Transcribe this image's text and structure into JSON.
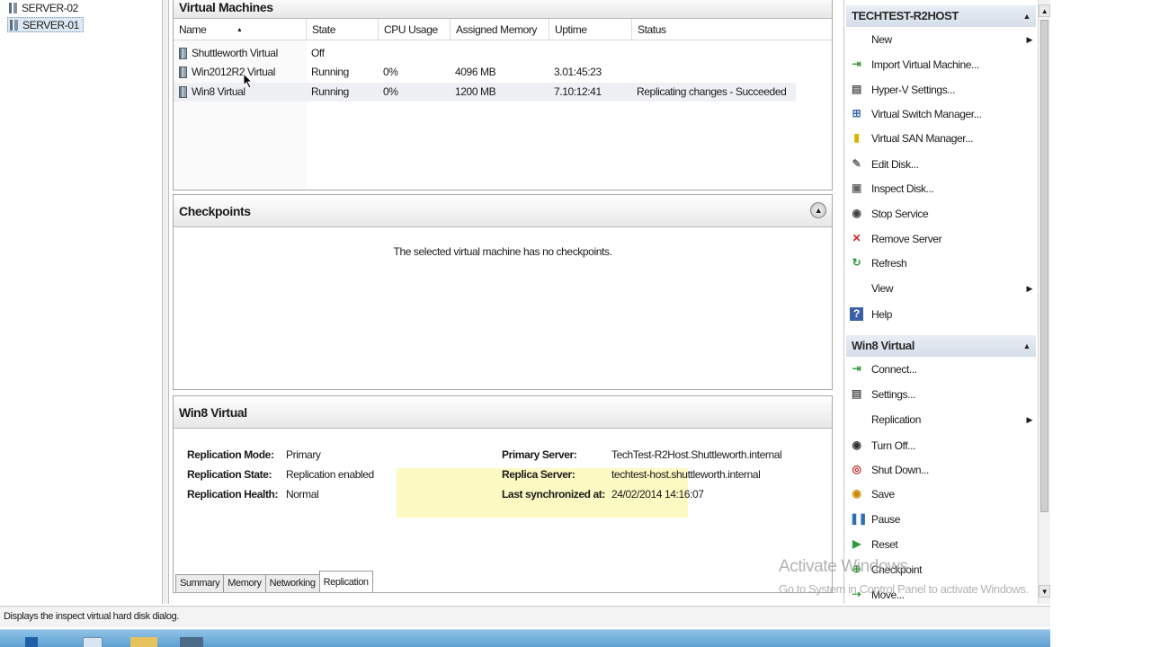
{
  "tree": {
    "items": [
      "SERVER-02",
      "SERVER-01"
    ]
  },
  "vm_panel": {
    "title": "Virtual Machines",
    "columns": [
      "Name",
      "State",
      "CPU Usage",
      "Assigned Memory",
      "Uptime",
      "Status"
    ],
    "rows": [
      {
        "name": "Shuttleworth Virtual",
        "state": "Off",
        "cpu": "",
        "memory": "",
        "uptime": "",
        "status": ""
      },
      {
        "name": "Win2012R2 Virtual",
        "state": "Running",
        "cpu": "0%",
        "memory": "4096 MB",
        "uptime": "3.01:45:23",
        "status": ""
      },
      {
        "name": "Win8 Virtual",
        "state": "Running",
        "cpu": "0%",
        "memory": "1200 MB",
        "uptime": "7.10:12:41",
        "status": "Replicating changes - Succeeded"
      }
    ]
  },
  "checkpoints": {
    "title": "Checkpoints",
    "empty_message": "The selected virtual machine has no checkpoints."
  },
  "details": {
    "title": "Win8 Virtual",
    "left": [
      {
        "label": "Replication Mode:",
        "value": "Primary"
      },
      {
        "label": "Replication State:",
        "value": "Replication enabled"
      },
      {
        "label": "Replication Health:",
        "value": "Normal"
      }
    ],
    "right": [
      {
        "label": "Primary Server:",
        "value": "TechTest-R2Host.Shuttleworth.internal"
      },
      {
        "label": "Replica Server:",
        "value": "techtest-host.shuttleworth.internal"
      },
      {
        "label": "Last synchronized at:",
        "value": "24/02/2014 14:16:07"
      }
    ],
    "tabs": [
      "Summary",
      "Memory",
      "Networking",
      "Replication"
    ]
  },
  "actions": {
    "host_title": "TECHTEST-R2HOST",
    "host_items": [
      "New",
      "Import Virtual Machine...",
      "Hyper-V Settings...",
      "Virtual Switch Manager...",
      "Virtual SAN Manager...",
      "Edit Disk...",
      "Inspect Disk...",
      "Stop Service",
      "Remove Server",
      "Refresh",
      "View",
      "Help"
    ],
    "vm_title": "Win8 Virtual",
    "vm_items": [
      "Connect...",
      "Settings...",
      "Replication",
      "Turn Off...",
      "Shut Down...",
      "Save",
      "Pause",
      "Reset",
      "Checkpoint",
      "Move..."
    ]
  },
  "status_bar": "Displays the inspect virtual hard disk dialog.",
  "watermark": {
    "line1": "Activate Windows",
    "line2": "Go to System in Control Panel to activate Windows."
  },
  "colors": {
    "accent": "#5d9fd0",
    "highlight": "#fdf8b8",
    "panel_header": "#e7e7e7"
  }
}
